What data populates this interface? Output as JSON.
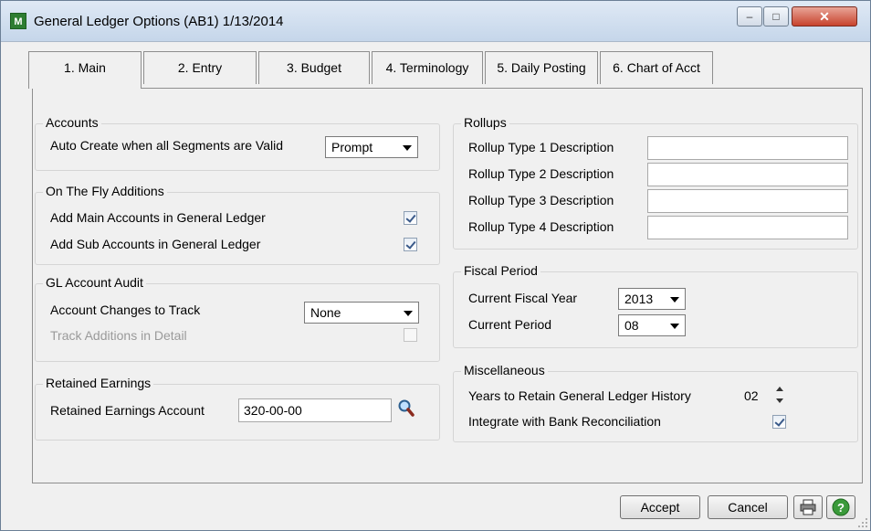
{
  "window": {
    "title": "General Ledger Options (AB1) 1/13/2014",
    "icon": "app-icon",
    "controls": [
      "minimize-icon",
      "maximize-icon",
      "close-icon"
    ]
  },
  "tabs": [
    {
      "label": "1. Main",
      "hotkey": "1",
      "active": true
    },
    {
      "label": "2. Entry",
      "hotkey": "2"
    },
    {
      "label": "3. Budget",
      "hotkey": "3"
    },
    {
      "label": "4. Terminology",
      "hotkey": "4"
    },
    {
      "label": "5. Daily Posting",
      "hotkey": "5"
    },
    {
      "label": "6. Chart of Acct",
      "hotkey": "6"
    }
  ],
  "accounts": {
    "title": "Accounts",
    "auto_create_label": "Auto Create when all Segments are Valid",
    "auto_create_value": "Prompt"
  },
  "on_the_fly": {
    "title": "On The Fly Additions",
    "main_label": "Add Main Accounts in General Ledger",
    "main_checked": true,
    "sub_label": "Add Sub Accounts in General Ledger",
    "sub_checked": true
  },
  "audit": {
    "title": "GL Account Audit",
    "changes_label": "Account Changes to Track",
    "changes_value": "None",
    "additions_label": "Track Additions in Detail",
    "additions_checked": false
  },
  "retained": {
    "title": "Retained Earnings",
    "account_label": "Retained Earnings Account",
    "account_value": "320-00-00",
    "lookup_icon": "magnifier-icon"
  },
  "rollups": {
    "title": "Rollups",
    "items": [
      {
        "label": "Rollup Type 1 Description",
        "value": ""
      },
      {
        "label": "Rollup Type 2 Description",
        "value": ""
      },
      {
        "label": "Rollup Type 3 Description",
        "value": ""
      },
      {
        "label": "Rollup Type 4 Description",
        "value": ""
      }
    ]
  },
  "fiscal": {
    "title": "Fiscal Period",
    "year_label": "Current Fiscal Year",
    "year_value": "2013",
    "period_label": "Current Period",
    "period_value": "08"
  },
  "misc": {
    "title": "Miscellaneous",
    "years_label": "Years to Retain General Ledger History",
    "years_value": "02",
    "bank_label": "Integrate with Bank Reconciliation",
    "bank_checked": true
  },
  "footer": {
    "accept_label": "Accept",
    "cancel_label": "Cancel",
    "print_icon": "printer-icon",
    "help_icon": "help-icon"
  },
  "colors": {
    "arrow": "#5aa832",
    "window_bg": "#f0f0f0",
    "titlebar": "#c5d6ea"
  }
}
